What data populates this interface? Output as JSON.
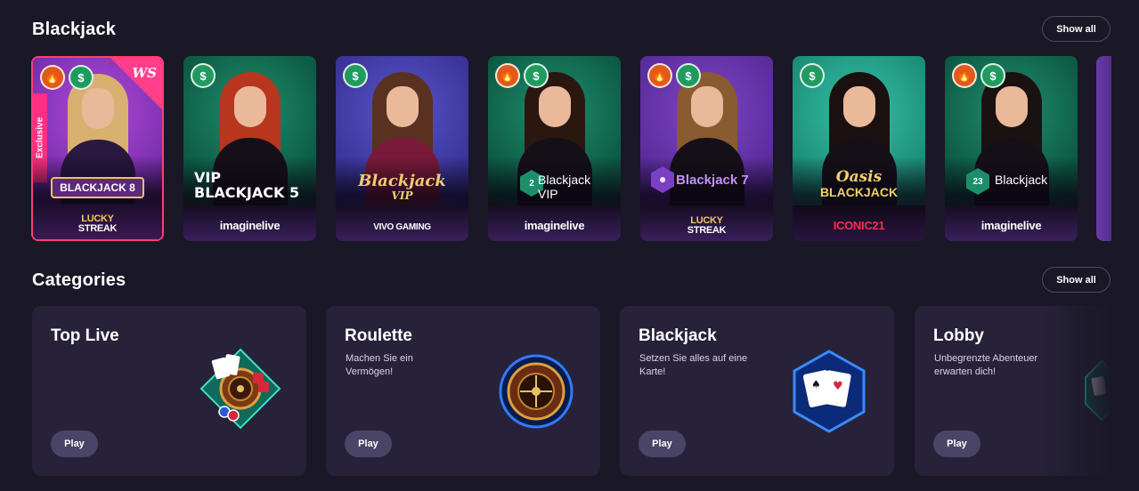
{
  "sections": {
    "blackjack": {
      "title": "Blackjack",
      "show_all": "Show all"
    },
    "categories": {
      "title": "Categories",
      "show_all": "Show all"
    }
  },
  "games": [
    {
      "title": "BLACKJACK 8",
      "title_sub": "8",
      "provider_line1": "LUCKY",
      "provider_line2": "STREAK",
      "tag": "Exclusive",
      "corner": "WS",
      "badges": [
        "fire-icon",
        "dollar-icon"
      ],
      "theme": "pink-purple"
    },
    {
      "title_line1": "VIP",
      "title_line2": "BLACKJACK 5",
      "provider": "imaginelive",
      "badges": [
        "dollar-icon"
      ],
      "theme": "green"
    },
    {
      "title_line1": "Blackjack",
      "title_line2": "VIP",
      "provider": "VIVO GAMING",
      "badges": [
        "dollar-icon"
      ],
      "theme": "blue"
    },
    {
      "title_line1": "Blackjack",
      "title_line2": "VIP",
      "table_number": "2",
      "provider": "imaginelive",
      "badges": [
        "fire-icon",
        "dollar-icon"
      ],
      "theme": "green"
    },
    {
      "title": "Blackjack 7",
      "provider_line1": "LUCKY",
      "provider_line2": "STREAK",
      "badges": [
        "fire-icon",
        "dollar-icon"
      ],
      "theme": "purple"
    },
    {
      "title_line1": "Oasis",
      "title_line2": "BLACKJACK",
      "provider": "ICONIC21",
      "badges": [
        "dollar-icon"
      ],
      "theme": "teal"
    },
    {
      "title": "Blackjack",
      "table_number": "23",
      "provider": "imaginelive",
      "badges": [
        "fire-icon",
        "dollar-icon"
      ],
      "theme": "green"
    }
  ],
  "categories": [
    {
      "title": "Top Live",
      "description": "",
      "play": "Play",
      "icon": "casino-table-icon"
    },
    {
      "title": "Roulette",
      "description": "Machen Sie ein Vermögen!",
      "play": "Play",
      "icon": "roulette-wheel-icon"
    },
    {
      "title": "Blackjack",
      "description": "Setzen Sie alles auf eine Karte!",
      "play": "Play",
      "icon": "playing-cards-icon"
    },
    {
      "title": "Lobby",
      "description": "Unbegrenzte Abenteuer erwarten dich!",
      "play": "Play",
      "icon": "lobby-icon"
    }
  ],
  "colors": {
    "background": "#1a1726",
    "card": "#27223a",
    "exclusive_accent": "#ff2f86",
    "fire_badge": "#e05a1a",
    "dollar_badge": "#1f9b5f"
  }
}
